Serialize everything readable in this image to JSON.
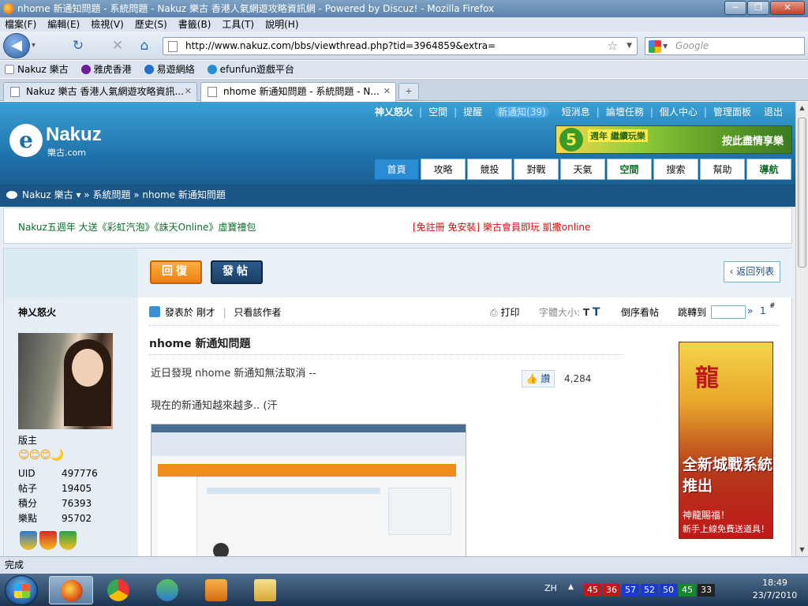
{
  "window": {
    "title": "nhome 新通知問題 - 系統問題 - Nakuz 樂古 香港人氣網遊攻略資訊網 - Powered by Discuz! - Mozilla Firefox"
  },
  "menu": [
    "檔案(F)",
    "編輯(E)",
    "檢視(V)",
    "歷史(S)",
    "書籤(B)",
    "工具(T)",
    "說明(H)"
  ],
  "nav": {
    "url": "http://www.nakuz.com/bbs/viewthread.php?tid=3964859&extra=",
    "search_placeholder": "Google"
  },
  "bookmarks": [
    {
      "label": "Nakuz 樂古",
      "color": "#cccccc"
    },
    {
      "label": "雅虎香港",
      "color": "#6b1d9a"
    },
    {
      "label": "易遊網絡",
      "color": "#2a6bd1"
    },
    {
      "label": "efunfun遊戲平台",
      "color": "#2a8cd1"
    }
  ],
  "tabs": [
    {
      "label": "Nakuz 樂古 香港人氣網遊攻略資訊...",
      "active": false
    },
    {
      "label": "nhome 新通知問題 - 系統問題 - N...",
      "active": true
    }
  ],
  "site": {
    "topnav": [
      "神乂怒火",
      "空間",
      "提醒",
      "新通知(39)",
      "短消息",
      "論壇任務",
      "個人中心",
      "管理面板",
      "退出"
    ],
    "logo_name": "Nakuz",
    "logo_sub": "樂古.com",
    "banner": {
      "badge": "5",
      "line1": "週年 繼續玩樂",
      "line2": "按此盡情享樂"
    },
    "mainnav": [
      "首頁",
      "攻略",
      "競投",
      "對戰",
      "天氣",
      "空間",
      "搜索",
      "幫助",
      "導航"
    ],
    "breadcrumb": "Nakuz 樂古 ▾  » 系統問題 » nhome 新通知問題",
    "promo_left": "Nakuz五週年 大送《彩虹汽泡》《誅天Online》虛寶禮包",
    "promo_right": "[免註冊 免安裝] 樂古會員即玩 凱撒online"
  },
  "thread": {
    "reply_label": "回復",
    "post_label": "發帖",
    "back_label": "返回列表",
    "author": "神乂怒火",
    "role": "版主",
    "stars": "😊😊😊🌙",
    "stats": [
      {
        "k": "UID",
        "v": "497776"
      },
      {
        "k": "帖子",
        "v": "19405"
      },
      {
        "k": "積分",
        "v": "76393"
      },
      {
        "k": "樂點",
        "v": "95702"
      }
    ],
    "posted": "發表於 剛才",
    "only_author": "只看該作者",
    "print": "打印",
    "fontsize": "字體大小:",
    "fontsize_t": "T",
    "reverse": "倒序看帖",
    "jump": "跳轉到",
    "jump_arrow": "»",
    "floor": "1",
    "floor_mark": "#",
    "title": "nhome 新通知問題",
    "body1": "近日發現 nhome 新通知無法取消 --",
    "body2": "現在的新通知越來越多.. (汗",
    "like_label": "讚",
    "like_count": "4,284",
    "ad": {
      "t1": "龍",
      "t2": "全新城戰系統推出",
      "t3": "神龍賜福！",
      "t4": "新手上線免費送道具！"
    }
  },
  "statusbar": "完成",
  "taskbar": {
    "lang": "ZH",
    "tray_numbers": [
      {
        "n": "45",
        "color": "#c0181a"
      },
      {
        "n": "36",
        "color": "#c0181a"
      },
      {
        "n": "57",
        "color": "#1a3ad0"
      },
      {
        "n": "52",
        "color": "#1a3ad0"
      },
      {
        "n": "50",
        "color": "#1a3ad0"
      },
      {
        "n": "45",
        "color": "#138a2a"
      },
      {
        "n": "33",
        "color": "#222222"
      }
    ],
    "time": "18:49",
    "date": "23/7/2010"
  }
}
